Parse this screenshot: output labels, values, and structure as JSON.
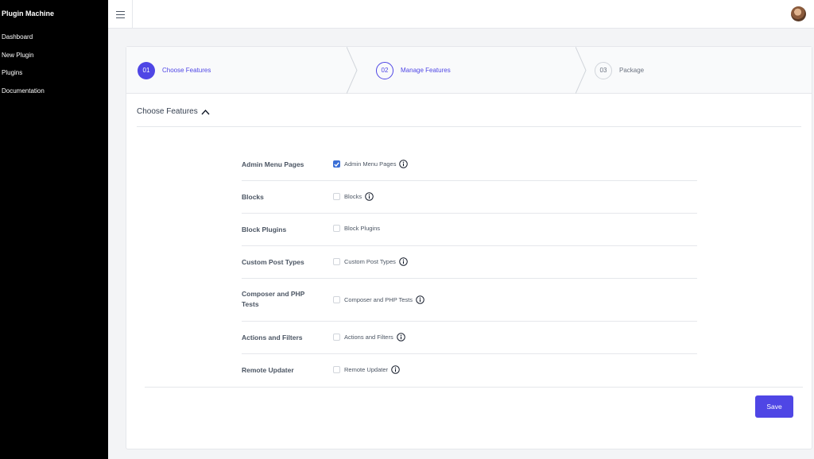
{
  "sidebar": {
    "brand": "Plugin Machine",
    "items": [
      {
        "label": "Dashboard"
      },
      {
        "label": "New Plugin"
      },
      {
        "label": "Plugins"
      },
      {
        "label": "Documentation"
      }
    ]
  },
  "stepper": {
    "steps": [
      {
        "number": "01",
        "label": "Choose Features",
        "state": "active"
      },
      {
        "number": "02",
        "label": "Manage Features",
        "state": "current"
      },
      {
        "number": "03",
        "label": "Package",
        "state": "pending"
      }
    ]
  },
  "section": {
    "title": "Choose Features",
    "toggle_icon": "chevron-up-icon"
  },
  "features": [
    {
      "label": "Admin Menu Pages",
      "option": "Admin Menu Pages",
      "checked": true,
      "info": true
    },
    {
      "label": "Blocks",
      "option": "Blocks",
      "checked": false,
      "info": true
    },
    {
      "label": "Block Plugins",
      "option": "Block Plugins",
      "checked": false,
      "info": false
    },
    {
      "label": "Custom Post Types",
      "option": "Custom Post Types",
      "checked": false,
      "info": true
    },
    {
      "label": "Composer and PHP Tests",
      "option": "Composer and PHP Tests",
      "checked": false,
      "info": true
    },
    {
      "label": "Actions and Filters",
      "option": "Actions and Filters",
      "checked": false,
      "info": true
    },
    {
      "label": "Remote Updater",
      "option": "Remote Updater",
      "checked": false,
      "info": true
    }
  ],
  "actions": {
    "save_label": "Save"
  },
  "colors": {
    "accent": "#4f46e5",
    "checkbox_checked": "#3b6fd6",
    "sidebar_bg": "#000000"
  }
}
